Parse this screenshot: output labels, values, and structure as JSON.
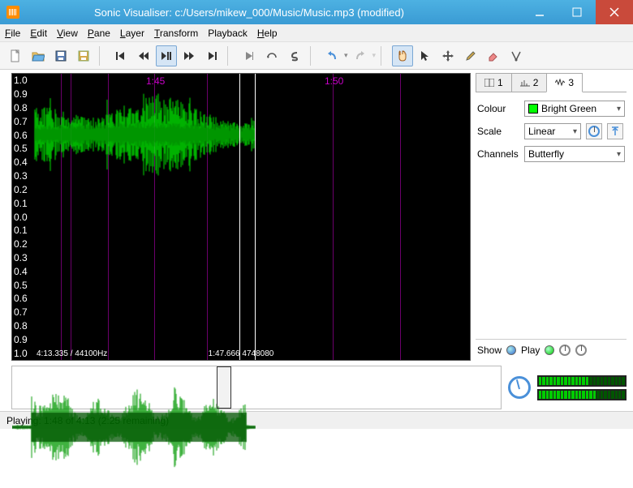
{
  "window": {
    "title": "Sonic Visualiser: c:/Users/mikew_000/Music/Music.mp3 (modified)"
  },
  "menu": {
    "file": "File",
    "edit": "Edit",
    "view": "View",
    "pane": "Pane",
    "layer": "Layer",
    "transform": "Transform",
    "playback": "Playback",
    "help": "Help"
  },
  "yaxis": [
    "1.0",
    "0.9",
    "0.8",
    "0.7",
    "0.6",
    "0.5",
    "0.4",
    "0.3",
    "0.2",
    "0.1",
    "0.0",
    "0.1",
    "0.2",
    "0.3",
    "0.4",
    "0.5",
    "0.6",
    "0.7",
    "0.8",
    "0.9",
    "1.0"
  ],
  "timeline": {
    "t1": "1:45",
    "t2": "1:50"
  },
  "wave_footer": {
    "left": "4:13.335 / 44100Hz",
    "center": "1:47.666   4748080"
  },
  "tabs": {
    "t1": "1",
    "t2": "2",
    "t3": "3"
  },
  "props": {
    "colour_label": "Colour",
    "colour_value": "Bright Green",
    "scale_label": "Scale",
    "scale_value": "Linear",
    "channels_label": "Channels",
    "channels_value": "Butterfly",
    "show_label": "Show",
    "play_label": "Play"
  },
  "status": {
    "text": "Playing: 1:48 of 4:13 (2:25 remaining)"
  },
  "colors": {
    "waveform": "#00ff00",
    "accent": "#4a90d9"
  }
}
